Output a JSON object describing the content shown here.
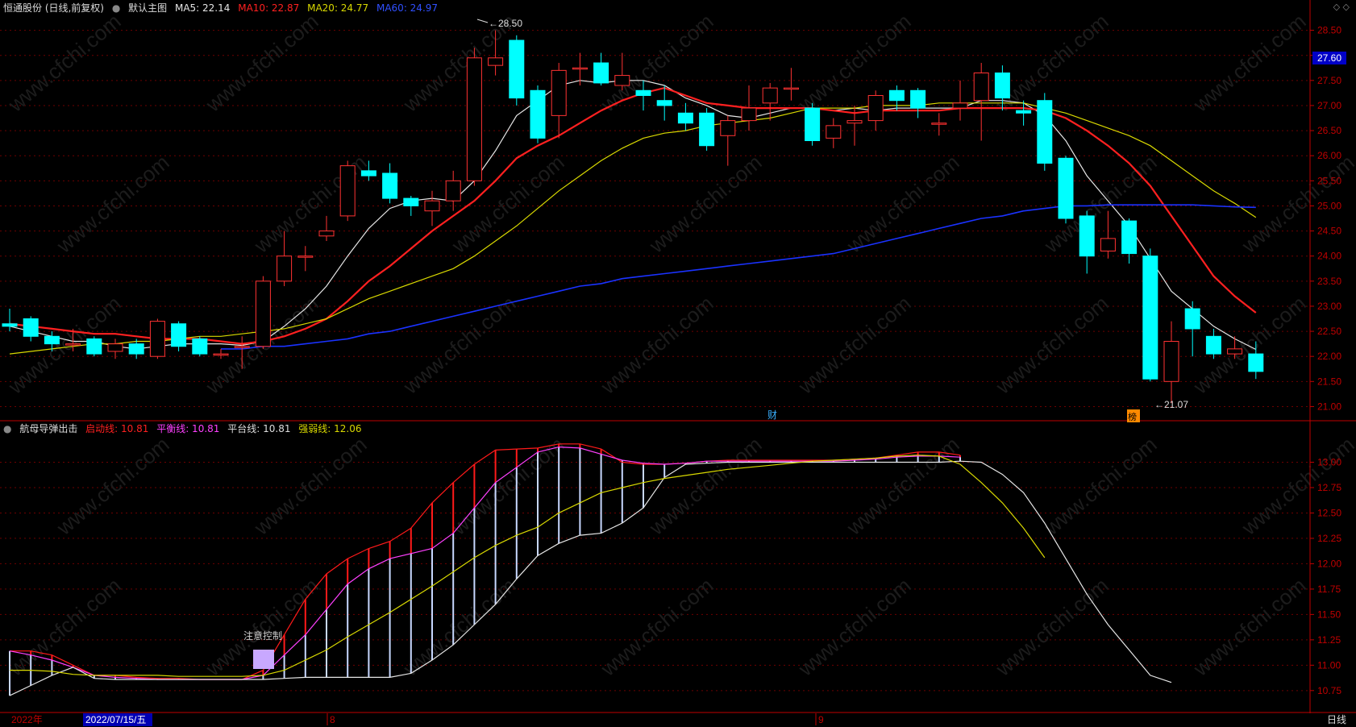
{
  "header": {
    "stock": "恒通股份 (日线,前复权)",
    "main_label": "默认主图",
    "ma5": "MA5: 22.14",
    "ma10": "MA10: 22.87",
    "ma20": "MA20: 24.77",
    "ma60": "MA60: 24.97"
  },
  "sub_header": {
    "title": "航母导弹出击",
    "qidong": "启动线: 10.81",
    "pingheng": "平衡线: 10.81",
    "pingtai": "平台线: 10.81",
    "qiangruo": "强弱线: 12.06"
  },
  "colors": {
    "up": "#ff3232",
    "down": "#00ffff",
    "ma5": "#e6e6e6",
    "ma10": "#ff2020",
    "ma20": "#d8d800",
    "ma60": "#1a32ff",
    "grid": "#6e0000",
    "axis": "#c00000"
  },
  "annotations": {
    "high": "28.50",
    "low": "21.07",
    "current": "27.60",
    "cai": "财",
    "bang": "榜",
    "zhuyi": "注意控制"
  },
  "x_axis": {
    "labels": [
      "2022年",
      "2022/07/15/五",
      "8",
      "9"
    ],
    "period": "日线"
  },
  "chart_data": [
    {
      "type": "candlestick",
      "title": "默认主图",
      "ylim": [
        20.75,
        28.75
      ],
      "yticks": [
        "21.00",
        "21.50",
        "22.00",
        "22.50",
        "23.00",
        "23.50",
        "24.00",
        "24.50",
        "25.00",
        "25.50",
        "26.00",
        "26.50",
        "27.00",
        "27.50",
        "28.00",
        "28.50"
      ],
      "candles": [
        [
          22.65,
          22.6,
          22.95,
          22.5
        ],
        [
          22.75,
          22.4,
          22.8,
          22.3
        ],
        [
          22.4,
          22.25,
          22.5,
          22.1
        ],
        [
          22.25,
          22.25,
          22.55,
          22.1
        ],
        [
          22.35,
          22.05,
          22.4,
          22.0
        ],
        [
          22.1,
          22.25,
          22.35,
          21.95
        ],
        [
          22.25,
          22.05,
          22.35,
          21.95
        ],
        [
          22.0,
          22.7,
          22.75,
          21.95
        ],
        [
          22.65,
          22.2,
          22.7,
          22.1
        ],
        [
          22.35,
          22.05,
          22.4,
          22.0
        ],
        [
          22.05,
          22.05,
          22.15,
          21.95
        ],
        [
          22.2,
          22.2,
          22.4,
          21.75
        ],
        [
          22.2,
          23.5,
          23.6,
          22.15
        ],
        [
          23.5,
          24.0,
          24.5,
          23.4
        ],
        [
          24.0,
          24.0,
          24.2,
          23.7
        ],
        [
          24.4,
          24.5,
          24.8,
          24.3
        ],
        [
          24.8,
          25.8,
          25.9,
          24.7
        ],
        [
          25.7,
          25.6,
          25.9,
          25.5
        ],
        [
          25.65,
          25.15,
          25.85,
          25.05
        ],
        [
          25.15,
          25.0,
          25.2,
          24.8
        ],
        [
          24.9,
          25.1,
          25.3,
          24.6
        ],
        [
          25.1,
          25.5,
          25.7,
          24.9
        ],
        [
          25.5,
          27.95,
          28.15,
          25.4
        ],
        [
          27.8,
          27.95,
          28.5,
          27.6
        ],
        [
          28.3,
          27.15,
          28.4,
          27.0
        ],
        [
          27.3,
          26.35,
          27.4,
          26.25
        ],
        [
          26.8,
          27.7,
          27.85,
          26.35
        ],
        [
          27.75,
          27.75,
          28.05,
          27.4
        ],
        [
          27.85,
          27.45,
          28.05,
          27.4
        ],
        [
          27.4,
          27.6,
          28.05,
          27.3
        ],
        [
          27.3,
          27.2,
          27.5,
          26.9
        ],
        [
          27.1,
          27.0,
          27.4,
          26.7
        ],
        [
          26.85,
          26.65,
          27.05,
          26.5
        ],
        [
          26.85,
          26.2,
          26.95,
          26.1
        ],
        [
          26.4,
          26.7,
          26.8,
          25.8
        ],
        [
          26.7,
          26.95,
          27.4,
          26.5
        ],
        [
          27.05,
          27.35,
          27.45,
          26.7
        ],
        [
          27.35,
          27.35,
          27.75,
          27.1
        ],
        [
          26.95,
          26.3,
          27.05,
          26.2
        ],
        [
          26.35,
          26.6,
          26.75,
          26.15
        ],
        [
          26.65,
          26.7,
          27.0,
          26.2
        ],
        [
          26.7,
          27.2,
          27.3,
          26.5
        ],
        [
          27.3,
          27.1,
          27.4,
          26.9
        ],
        [
          27.3,
          26.95,
          27.35,
          26.75
        ],
        [
          26.65,
          26.65,
          26.85,
          26.4
        ],
        [
          26.95,
          27.05,
          27.5,
          26.7
        ],
        [
          27.1,
          27.65,
          27.85,
          26.3
        ],
        [
          27.65,
          27.15,
          27.8,
          26.9
        ],
        [
          26.9,
          26.85,
          27.1,
          26.6
        ],
        [
          27.1,
          25.85,
          27.25,
          25.7
        ],
        [
          25.95,
          24.75,
          26.0,
          24.65
        ],
        [
          24.8,
          24.0,
          24.9,
          23.65
        ],
        [
          24.1,
          24.35,
          24.9,
          23.95
        ],
        [
          24.7,
          24.05,
          24.75,
          23.85
        ],
        [
          24.0,
          21.55,
          24.15,
          21.5
        ],
        [
          21.5,
          22.3,
          22.7,
          21.07
        ],
        [
          22.95,
          22.55,
          23.1,
          22.0
        ],
        [
          22.4,
          22.05,
          22.55,
          21.95
        ],
        [
          22.05,
          22.15,
          22.4,
          21.95
        ],
        [
          22.05,
          21.7,
          22.3,
          21.55
        ]
      ],
      "series": [
        {
          "name": "MA5",
          "values": [
            22.6,
            22.5,
            22.4,
            22.3,
            22.3,
            22.2,
            22.15,
            22.2,
            22.25,
            22.25,
            22.25,
            22.22,
            22.3,
            22.6,
            22.95,
            23.4,
            24.0,
            24.55,
            24.95,
            25.1,
            25.15,
            25.1,
            25.5,
            26.1,
            26.8,
            27.1,
            27.4,
            27.5,
            27.45,
            27.5,
            27.5,
            27.4,
            27.15,
            27.0,
            26.8,
            26.75,
            26.85,
            26.95,
            26.95,
            26.9,
            26.95,
            26.9,
            26.95,
            26.95,
            26.95,
            26.95,
            27.1,
            27.1,
            27.05,
            26.8,
            26.3,
            25.6,
            25.1,
            24.6,
            23.95,
            23.3,
            22.95,
            22.6,
            22.35,
            22.14
          ]
        },
        {
          "name": "MA10",
          "values": [
            22.65,
            22.6,
            22.55,
            22.5,
            22.45,
            22.45,
            22.4,
            22.35,
            22.35,
            22.35,
            22.3,
            22.25,
            22.3,
            22.4,
            22.55,
            22.75,
            23.1,
            23.5,
            23.8,
            24.15,
            24.5,
            24.8,
            25.1,
            25.5,
            25.95,
            26.2,
            26.4,
            26.65,
            26.9,
            27.1,
            27.25,
            27.35,
            27.2,
            27.05,
            27.0,
            26.95,
            26.95,
            26.95,
            26.95,
            26.9,
            26.85,
            26.9,
            26.9,
            26.9,
            26.9,
            26.95,
            26.95,
            26.95,
            26.95,
            26.9,
            26.75,
            26.5,
            26.2,
            25.85,
            25.4,
            24.8,
            24.2,
            23.6,
            23.2,
            22.87
          ]
        },
        {
          "name": "MA20",
          "values": [
            22.05,
            22.1,
            22.15,
            22.2,
            22.25,
            22.25,
            22.3,
            22.3,
            22.35,
            22.4,
            22.4,
            22.45,
            22.5,
            22.55,
            22.65,
            22.75,
            22.95,
            23.15,
            23.3,
            23.45,
            23.6,
            23.75,
            24.0,
            24.3,
            24.6,
            24.95,
            25.3,
            25.6,
            25.9,
            26.15,
            26.35,
            26.45,
            26.5,
            26.6,
            26.65,
            26.7,
            26.75,
            26.85,
            26.95,
            26.95,
            26.95,
            27.0,
            27.0,
            27.0,
            27.05,
            27.05,
            27.05,
            27.05,
            27.05,
            26.95,
            26.85,
            26.7,
            26.55,
            26.4,
            26.2,
            25.9,
            25.6,
            25.3,
            25.05,
            24.77
          ]
        },
        {
          "name": "MA60",
          "values": [
            null,
            null,
            null,
            null,
            null,
            null,
            null,
            null,
            null,
            null,
            22.15,
            22.15,
            22.2,
            22.2,
            22.25,
            22.3,
            22.35,
            22.45,
            22.5,
            22.6,
            22.7,
            22.8,
            22.9,
            23.0,
            23.1,
            23.2,
            23.3,
            23.4,
            23.45,
            23.55,
            23.6,
            23.65,
            23.7,
            23.75,
            23.8,
            23.85,
            23.9,
            23.95,
            24.0,
            24.05,
            24.15,
            24.25,
            24.35,
            24.45,
            24.55,
            24.65,
            24.75,
            24.8,
            24.9,
            24.95,
            25.0,
            25.0,
            25.02,
            25.02,
            25.02,
            25.02,
            25.02,
            25.0,
            24.98,
            24.97
          ]
        }
      ]
    },
    {
      "type": "line",
      "title": "航母导弹出击",
      "ylim": [
        10.55,
        13.25
      ],
      "yticks": [
        "10.75",
        "11.00",
        "11.25",
        "11.50",
        "11.75",
        "12.00",
        "12.25",
        "12.50",
        "12.75",
        "13.00"
      ],
      "series": [
        {
          "name": "启动线",
          "values": [
            11.14,
            11.14,
            11.1,
            11.0,
            10.9,
            10.9,
            10.88,
            10.87,
            10.87,
            10.86,
            10.86,
            10.86,
            10.95,
            11.3,
            11.65,
            11.9,
            12.05,
            12.15,
            12.22,
            12.35,
            12.6,
            12.8,
            12.98,
            13.12,
            13.13,
            13.14,
            13.18,
            13.18,
            13.13,
            13.0,
            12.98,
            12.98,
            12.99,
            13.01,
            13.02,
            13.02,
            13.02,
            13.02,
            13.02,
            13.02,
            13.03,
            13.04,
            13.07,
            13.1,
            13.1,
            13.07
          ]
        },
        {
          "name": "平衡线",
          "values": [
            11.14,
            11.1,
            11.05,
            10.98,
            10.9,
            10.88,
            10.87,
            10.86,
            10.86,
            10.86,
            10.86,
            10.86,
            10.9,
            11.1,
            11.3,
            11.55,
            11.8,
            11.95,
            12.05,
            12.1,
            12.15,
            12.3,
            12.55,
            12.8,
            12.95,
            13.1,
            13.15,
            13.14,
            13.08,
            13.02,
            12.99,
            12.98,
            12.99,
            13.01,
            13.01,
            13.01,
            13.01,
            13.01,
            13.01,
            13.01,
            13.02,
            13.03,
            13.05,
            13.06,
            13.06,
            13.05
          ]
        },
        {
          "name": "平台线",
          "values": [
            10.7,
            10.8,
            10.9,
            10.98,
            10.87,
            10.86,
            10.86,
            10.86,
            10.86,
            10.86,
            10.86,
            10.86,
            10.86,
            10.87,
            10.88,
            10.88,
            10.88,
            10.88,
            10.88,
            10.92,
            11.05,
            11.2,
            11.4,
            11.6,
            11.85,
            12.08,
            12.2,
            12.28,
            12.3,
            12.4,
            12.55,
            12.85,
            12.98,
            12.99,
            13.0,
            13.0,
            13.0,
            13.0,
            13.0,
            13.0,
            13.0,
            13.0,
            13.0,
            13.0,
            13.0,
            13.01,
            13.0,
            12.88,
            12.7,
            12.4,
            12.05,
            11.7,
            11.4,
            11.15,
            10.9,
            10.83
          ]
        },
        {
          "name": "强弱线",
          "values": [
            10.95,
            10.95,
            10.94,
            10.91,
            10.9,
            10.9,
            10.9,
            10.9,
            10.89,
            10.89,
            10.89,
            10.89,
            10.9,
            10.95,
            11.05,
            11.15,
            11.28,
            11.4,
            11.52,
            11.65,
            11.78,
            11.92,
            12.06,
            12.18,
            12.28,
            12.36,
            12.5,
            12.6,
            12.7,
            12.75,
            12.8,
            12.84,
            12.87,
            12.9,
            12.93,
            12.95,
            12.97,
            12.99,
            13.01,
            13.02,
            13.03,
            13.04,
            13.06,
            13.07,
            13.06,
            12.98,
            12.8,
            12.6,
            12.35,
            12.06
          ]
        }
      ]
    }
  ]
}
